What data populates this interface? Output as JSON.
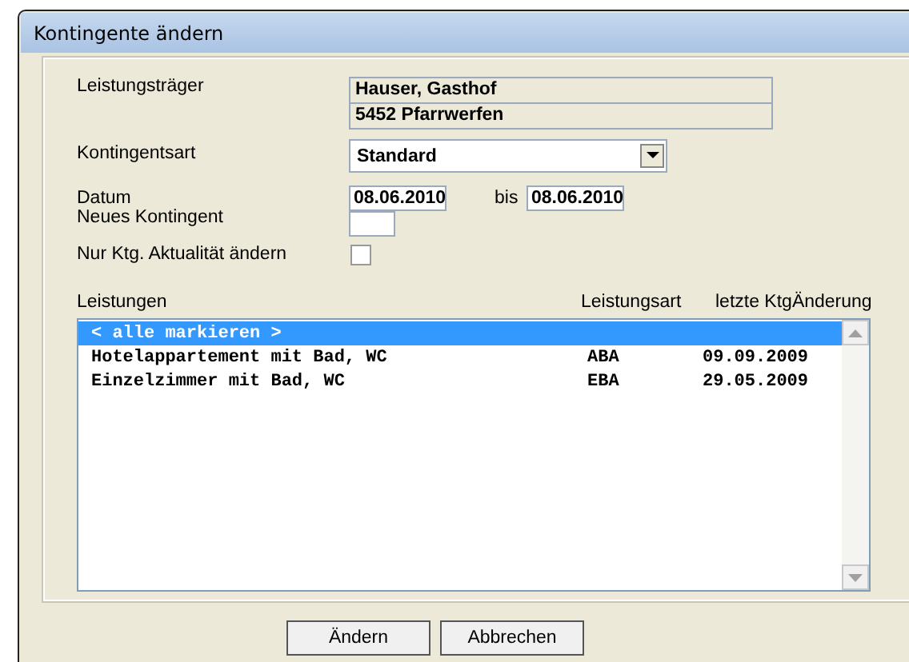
{
  "window": {
    "title": "Kontingente ändern"
  },
  "fields": {
    "leistungstraeger_label": "Leistungsträger",
    "leistungstraeger_name": "Hauser, Gasthof",
    "leistungstraeger_ort": "5452 Pfarrwerfen",
    "kontingentsart_label": "Kontingentsart",
    "kontingentsart_value": "Standard",
    "datum_label": "Datum",
    "datum_from": "08.06.2010",
    "bis_label": "bis",
    "datum_to": "08.06.2010",
    "neues_kontingent_label": "Neues Kontingent",
    "nur_aktualitaet_label": "Nur Ktg. Aktualität ändern",
    "nur_aktualitaet_checked": false
  },
  "list": {
    "columns": [
      "Leistungen",
      "Leistungsart",
      "letzte KtgÄnderung"
    ],
    "rows": [
      {
        "name": "< alle markieren >",
        "selected": true
      },
      {
        "name": "Hotelappartement mit Bad, WC",
        "art": "ABA",
        "date": "09.09.2009",
        "selected": false
      },
      {
        "name": "Einzelzimmer mit Bad, WC",
        "art": "EBA",
        "date": "29.05.2009",
        "selected": false
      }
    ]
  },
  "buttons": [
    "Ändern",
    "Abbrechen"
  ]
}
